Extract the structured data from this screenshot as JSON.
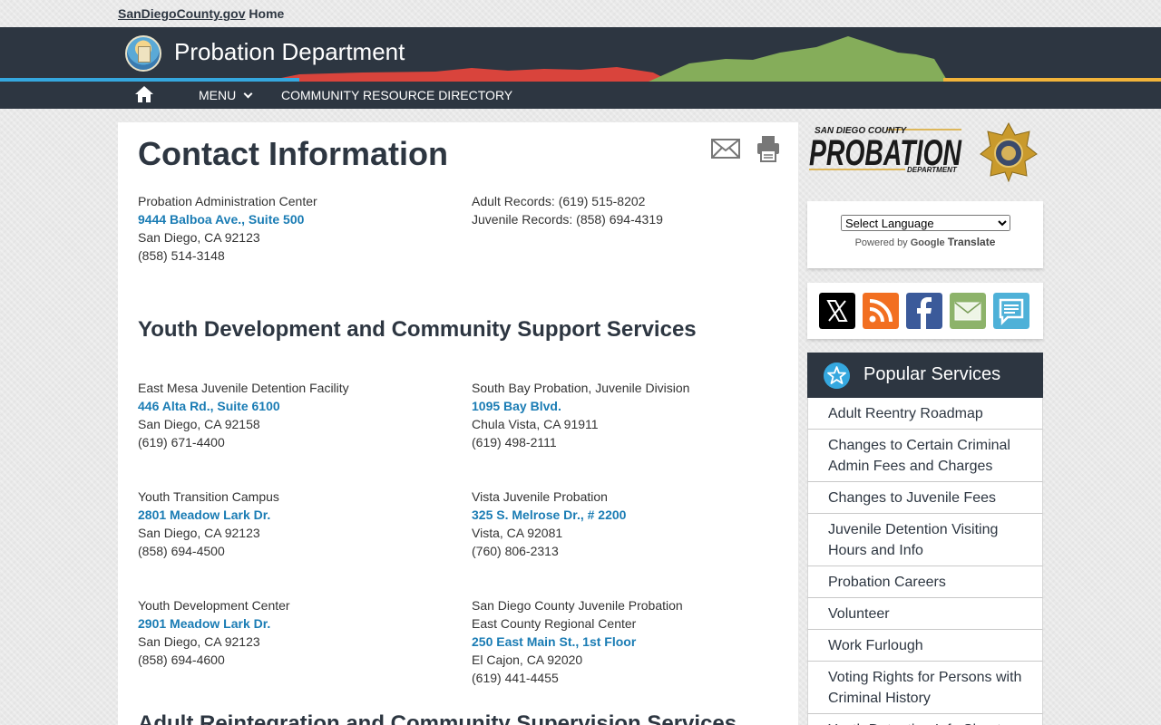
{
  "topbar": {
    "site_link": "SanDiegoCounty.gov",
    "home_label": "Home"
  },
  "header": {
    "title": "Probation Department"
  },
  "nav": {
    "menu_label": "MENU",
    "community_link": "COMMUNITY RESOURCE DIRECTORY"
  },
  "main": {
    "title": "Contact Information",
    "admin": {
      "name": "Probation Administration Center",
      "address": "9444 Balboa Ave., Suite 500",
      "city": "San Diego, CA 92123",
      "phone": "(858) 514-3148"
    },
    "records": {
      "adult": "Adult Records:  (619) 515-8202",
      "juvenile": "Juvenile Records:  (858) 694-4319"
    },
    "youth_heading": "Youth Development and Community Support Services",
    "facilities": [
      {
        "name": "East Mesa Juvenile Detention Facility",
        "address": "446 Alta Rd., Suite 6100",
        "city": "San Diego, CA 92158",
        "phone": "(619) 671-4400"
      },
      {
        "name": "South Bay Probation, Juvenile Division",
        "address": "1095 Bay Blvd.",
        "city": "Chula Vista, CA 91911",
        "phone": "(619) 498-2111"
      },
      {
        "name": "Youth Transition Campus",
        "address": "2801 Meadow Lark Dr.",
        "city": "San Diego, CA 92123",
        "phone": "(858) 694-4500"
      },
      {
        "name": "Vista Juvenile Probation",
        "address": "325 S. Melrose Dr., # 2200",
        "city": "Vista, CA 92081",
        "phone": "(760) 806-2313"
      },
      {
        "name": "Youth Development Center",
        "address": "2901 Meadow Lark Dr.",
        "city": "San Diego, CA 92123",
        "phone": "(858) 694-4600"
      },
      {
        "name": "San Diego County Juvenile Probation",
        "subname": "East County Regional Center",
        "address": "250 East Main St., 1st Floor",
        "city": "El Cajon, CA 92020",
        "phone": "(619) 441-4455"
      }
    ],
    "adult_heading": "Adult Reintegration and Community Supervision Services"
  },
  "sidebar": {
    "logo": {
      "county": "SAN DIEGO COUNTY",
      "name": "PROBATION",
      "dept": "DEPARTMENT"
    },
    "translate": {
      "select_value": "Select Language",
      "powered_by": "Powered by",
      "google": "Google",
      "translate": "Translate"
    },
    "popular": {
      "title": "Popular Services",
      "items": [
        "Adult Reentry Roadmap",
        "Changes to Certain Criminal Admin Fees and Charges",
        "Changes to Juvenile Fees",
        "Juvenile Detention Visiting Hours and Info",
        "Probation Careers",
        "Volunteer",
        "Work Furlough",
        "Voting Rights for Persons with Criminal History",
        "Youth Detention Info Sheet"
      ]
    }
  },
  "colors": {
    "navy": "#2d3641",
    "link": "#1a7cb4",
    "blue_line": "#35a8df",
    "red": "#d9443c",
    "green": "#85ad5a",
    "gold": "#f2b43a"
  }
}
